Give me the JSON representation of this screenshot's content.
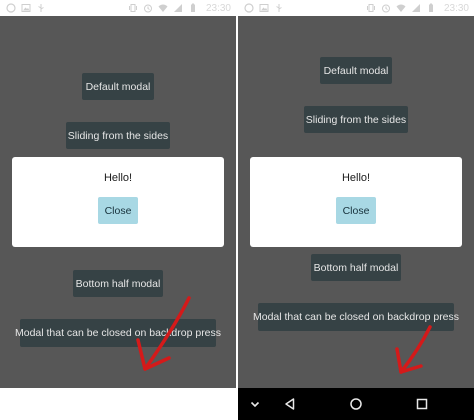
{
  "status_bar": {
    "time": "23:30",
    "icons": [
      "whatsapp-icon",
      "image-icon",
      "usb-icon",
      "vibrate-icon",
      "alarm-icon",
      "wifi-icon",
      "signal-icon",
      "battery-icon"
    ]
  },
  "app": {
    "buttons": {
      "default": "Default modal",
      "sliding": "Sliding from the sides",
      "bottom_half": "Bottom half modal",
      "backdrop": "Modal that can be closed on backdrop press"
    }
  },
  "modal": {
    "title": "Hello!",
    "close_label": "Close"
  },
  "nav_bar": {
    "icons": [
      "chevron-down-icon",
      "back-icon",
      "home-icon",
      "recents-icon"
    ]
  },
  "colors": {
    "backdrop": "#575757",
    "button_bg": "#364245",
    "close_button_bg": "#a8d8e4",
    "annotation_arrow": "#d41a1a"
  }
}
